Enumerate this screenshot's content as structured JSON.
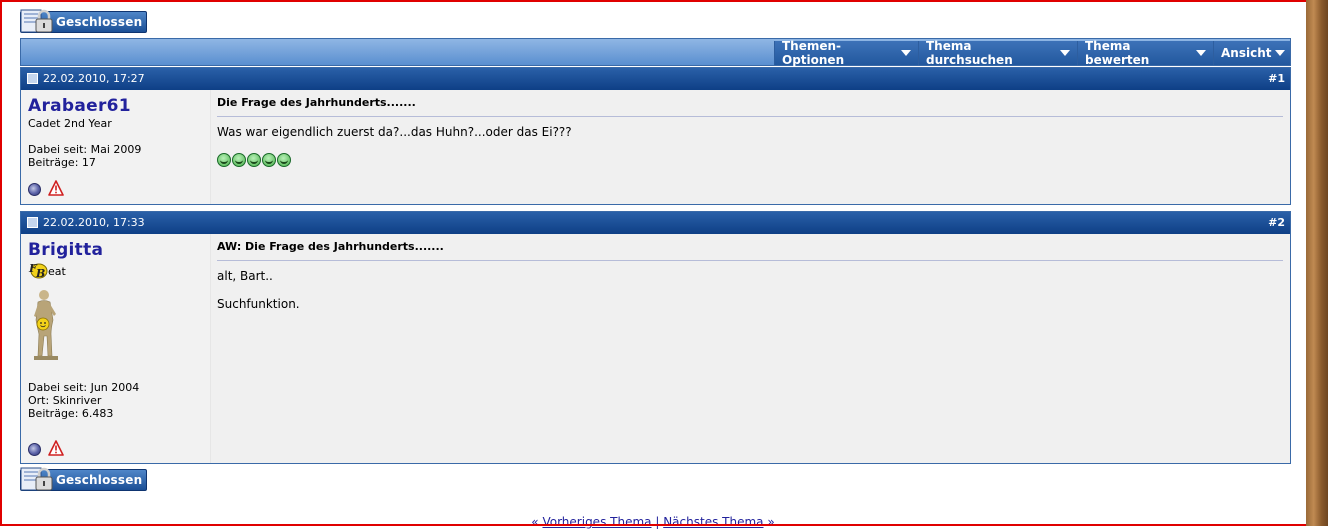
{
  "closed_button": {
    "label": "Geschlossen"
  },
  "toolbar": {
    "menus": [
      {
        "label": "Themen-Optionen"
      },
      {
        "label": "Thema durchsuchen"
      },
      {
        "label": "Thema bewerten"
      },
      {
        "label": "Ansicht"
      }
    ]
  },
  "posts": [
    {
      "date": "22.02.2010, 17:27",
      "number": "#1",
      "username": "Arabaer61",
      "usertitle": "Cadet 2nd Year",
      "joined": "Dabei seit: Mai 2009",
      "posts_count": "Beiträge: 17",
      "title": "Die Frage des Jahrhunderts.......",
      "text": [
        "Was war eigendlich zuerst da?...das Huhn?...oder das Ei???"
      ],
      "smilie_count": 5
    },
    {
      "date": "22.02.2010, 17:33",
      "number": "#2",
      "username": "Brigitta",
      "usertitle": "eat",
      "badge": "FB",
      "joined": "Dabei seit: Jun 2004",
      "location": "Ort: Skinriver",
      "posts_count": "Beiträge: 6.483",
      "title": "AW: Die Frage des Jahrhunderts.......",
      "text": [
        "alt, Bart..",
        "Suchfunktion."
      ]
    }
  ],
  "footer": {
    "prev_arrow": "«",
    "prev": "Vorheriges Thema",
    "separator": "|",
    "next": "Nächstes Thema",
    "next_arrow": "»"
  },
  "colors": {
    "frame_border": "#e00000",
    "header_blue": "#0e3f86",
    "username": "#22229c"
  }
}
